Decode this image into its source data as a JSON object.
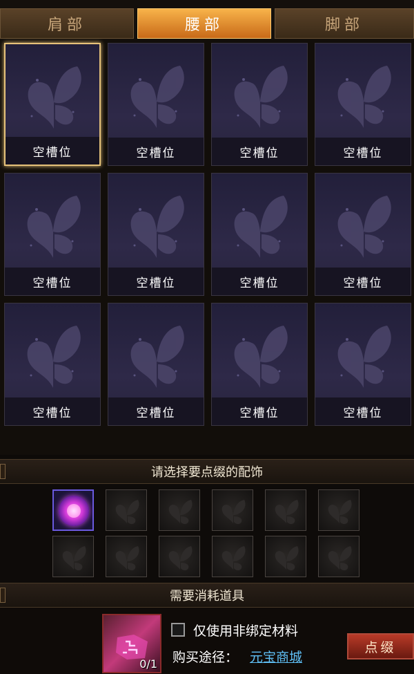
{
  "tabs": [
    {
      "label": "肩部",
      "active": false
    },
    {
      "label": "腰部",
      "active": true
    },
    {
      "label": "脚部",
      "active": false
    }
  ],
  "slots": [
    {
      "label": "空槽位",
      "selected": true
    },
    {
      "label": "空槽位",
      "selected": false
    },
    {
      "label": "空槽位",
      "selected": false
    },
    {
      "label": "空槽位",
      "selected": false
    },
    {
      "label": "空槽位",
      "selected": false
    },
    {
      "label": "空槽位",
      "selected": false
    },
    {
      "label": "空槽位",
      "selected": false
    },
    {
      "label": "空槽位",
      "selected": false
    },
    {
      "label": "空槽位",
      "selected": false
    },
    {
      "label": "空槽位",
      "selected": false
    },
    {
      "label": "空槽位",
      "selected": false
    },
    {
      "label": "空槽位",
      "selected": false
    }
  ],
  "accessory_section": {
    "title": "请选择要点缀的配饰"
  },
  "accessories": [
    {
      "icon": "purple-orb-icon",
      "filled": true
    },
    {
      "icon": "butterfly-icon",
      "filled": false
    },
    {
      "icon": "butterfly-icon",
      "filled": false
    },
    {
      "icon": "butterfly-icon",
      "filled": false
    },
    {
      "icon": "butterfly-icon",
      "filled": false
    },
    {
      "icon": "butterfly-icon",
      "filled": false
    },
    {
      "icon": "butterfly-icon",
      "filled": false
    },
    {
      "icon": "butterfly-icon",
      "filled": false
    },
    {
      "icon": "butterfly-icon",
      "filled": false
    },
    {
      "icon": "butterfly-icon",
      "filled": false
    },
    {
      "icon": "butterfly-icon",
      "filled": false
    },
    {
      "icon": "butterfly-icon",
      "filled": false
    }
  ],
  "consume_section": {
    "title": "需要消耗道具"
  },
  "material": {
    "quantity": "0/1",
    "icon": "rune-scroll-icon"
  },
  "option": {
    "label": "仅使用非绑定材料",
    "checked": false
  },
  "purchase": {
    "label": "购买途径：",
    "link": "元宝商城"
  },
  "action": {
    "label": "点缀"
  },
  "colors": {
    "active_tab": "#f39a36",
    "selected_border": "#e6c27a",
    "link": "#5fbff5",
    "button": "#b83a28"
  }
}
